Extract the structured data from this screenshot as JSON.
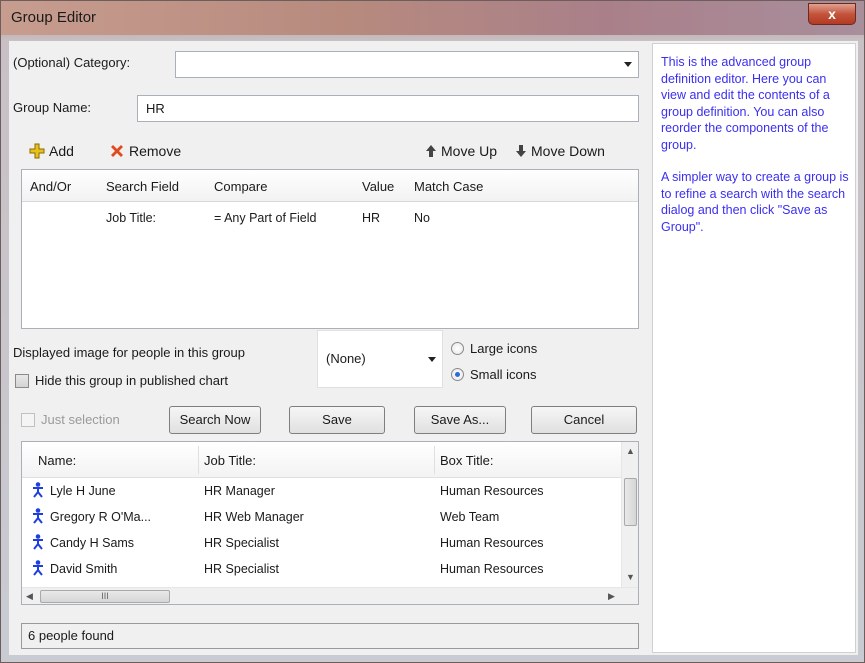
{
  "window": {
    "title": "Group Editor",
    "close_label": "x"
  },
  "form": {
    "category_label": "(Optional) Category:",
    "category_value": "",
    "group_name_label": "Group Name:",
    "group_name_value": "HR"
  },
  "toolbar": {
    "add_label": "Add",
    "remove_label": "Remove",
    "move_up_label": "Move Up",
    "move_down_label": "Move Down"
  },
  "definition_grid": {
    "columns": [
      "And/Or",
      "Search Field",
      "Compare",
      "Value",
      "Match Case"
    ],
    "rows": [
      {
        "and_or": "",
        "search_field": "Job Title:",
        "compare": "= Any Part of Field",
        "value": "HR",
        "match_case": "No"
      }
    ]
  },
  "image_options": {
    "displayed_image_label": "Displayed image for people in this group",
    "image_select_value": "(None)",
    "hide_group_label": "Hide this group in published chart",
    "large_icons_label": "Large icons",
    "small_icons_label": "Small icons",
    "selected_icon_size": "small"
  },
  "actions": {
    "just_selection_label": "Just selection",
    "search_now_label": "Search Now",
    "save_label": "Save",
    "save_as_label": "Save As...",
    "cancel_label": "Cancel"
  },
  "results": {
    "columns": [
      "Name:",
      "Job Title:",
      "Box Title:"
    ],
    "rows": [
      {
        "name": "Lyle H June",
        "job_title": "HR Manager",
        "box_title": "Human Resources"
      },
      {
        "name": "Gregory R O'Ma...",
        "job_title": "HR Web Manager",
        "box_title": "Web Team"
      },
      {
        "name": "Candy H Sams",
        "job_title": "HR Specialist",
        "box_title": "Human Resources"
      },
      {
        "name": "David Smith",
        "job_title": "HR Specialist",
        "box_title": "Human Resources"
      }
    ],
    "hscroll_thumb": "III",
    "status_text": "6 people found"
  },
  "help": {
    "paragraph1": "This is the advanced group definition editor. Here you can view and edit the contents of a group definition. You can also reorder the components of the group.",
    "paragraph2": "A simpler way to create a group is to refine a search with the search dialog and then click \"Save as Group\"."
  },
  "colors": {
    "help_text": "#3b2ff0",
    "person_icon": "#1d3fe0",
    "remove_icon": "#e04a1c",
    "add_icon": "#e6c21a"
  }
}
